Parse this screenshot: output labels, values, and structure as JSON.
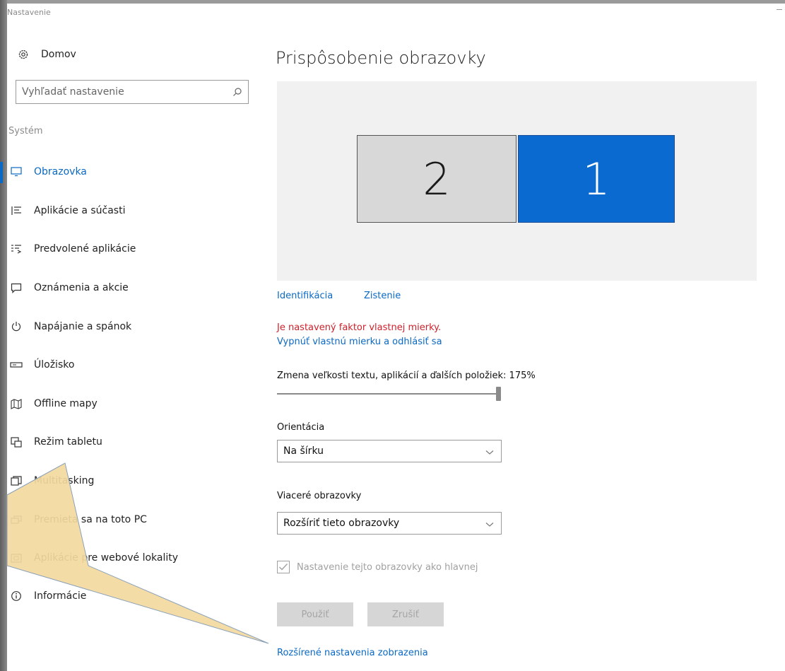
{
  "window": {
    "title": "Nastavenie"
  },
  "sidebar": {
    "home_label": "Domov",
    "search_placeholder": "Vyhľadať nastavenie",
    "section_label": "Systém",
    "items": [
      {
        "label": "Obrazovka",
        "icon": "monitor-icon",
        "active": true
      },
      {
        "label": "Aplikácie a súčasti",
        "icon": "apps-list-icon"
      },
      {
        "label": "Predvolené aplikácie",
        "icon": "default-apps-icon"
      },
      {
        "label": "Oznámenia a akcie",
        "icon": "notification-icon"
      },
      {
        "label": "Napájanie a spánok",
        "icon": "power-icon"
      },
      {
        "label": "Úložisko",
        "icon": "storage-icon"
      },
      {
        "label": "Offline mapy",
        "icon": "map-icon"
      },
      {
        "label": "Režim tabletu",
        "icon": "tablet-icon"
      },
      {
        "label": "Multitasking",
        "icon": "multitask-icon"
      },
      {
        "label": "Premieta sa na toto PC",
        "icon": "projecting-icon"
      },
      {
        "label": "Aplikácie pre webové lokality",
        "icon": "web-apps-icon"
      },
      {
        "label": "Informácie",
        "icon": "info-icon"
      }
    ]
  },
  "main": {
    "title": "Prispôsobenie obrazovky",
    "monitors": {
      "secondary": "2",
      "primary": "1"
    },
    "identify_link": "Identifikácia",
    "detect_link": "Zistenie",
    "warning": "Je nastavený faktor vlastnej mierky.",
    "disable_link": "Vypnúť vlastnú mierku a odhlásiť sa",
    "scale_label": "Zmena veľkosti textu, aplikácií a ďalších položiek: 175%",
    "scale_value_percent": 100,
    "orientation_label": "Orientácia",
    "orientation_value": "Na šírku",
    "multi_label": "Viaceré obrazovky",
    "multi_value": "Rozšíriť tieto obrazovky",
    "main_display_checkbox": "Nastavenie tejto obrazovky ako hlavnej",
    "apply_button": "Použiť",
    "cancel_button": "Zrušiť",
    "advanced_link": "Rozšírené nastavenia zobrazenia"
  },
  "colors": {
    "accent": "#0a69c4",
    "warning": "#d0202a",
    "primary_monitor": "#0a6ad0",
    "callout_fill": "#f3d9a0"
  }
}
